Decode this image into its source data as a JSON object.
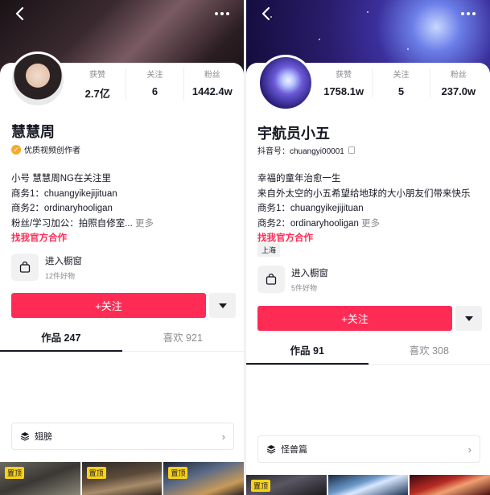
{
  "colors": {
    "accent": "#fe2c55",
    "pin": "#f8d21a",
    "text": "#161823",
    "muted": "#8a8b91"
  },
  "left": {
    "stats": [
      {
        "label": "获赞",
        "value": "2.7亿"
      },
      {
        "label": "关注",
        "value": "6"
      },
      {
        "label": "粉丝",
        "value": "1442.4w"
      }
    ],
    "name": "慧慧周",
    "badge": "优质视频创作者",
    "bio": [
      "小号 慧慧周NG在关注里",
      "商务1：chuangyikejijituan",
      "商务2：ordinaryhooligan",
      "粉丝/学习加公：拍照自修室..."
    ],
    "more": "更多",
    "link": "找我官方合作",
    "shop": {
      "title": "进入橱窗",
      "sub": "12件好物"
    },
    "follow": "+关注",
    "tabs": [
      {
        "label": "作品 247"
      },
      {
        "label": "喜欢 921"
      }
    ],
    "collection": "翅膀",
    "pin": "置顶"
  },
  "right": {
    "stats": [
      {
        "label": "获赞",
        "value": "1758.1w"
      },
      {
        "label": "关注",
        "value": "5"
      },
      {
        "label": "粉丝",
        "value": "237.0w"
      }
    ],
    "name": "宇航员小五",
    "id": "抖音号：chuangyi00001",
    "bio": [
      "幸福的童年治愈一生",
      "来自外太空的小五希望给地球的大小朋友们带来快乐",
      "商务1：chuangyikejijituan",
      "商务2：ordinaryhooligan"
    ],
    "more": "更多",
    "link": "找我官方合作",
    "location": "上海",
    "shop": {
      "title": "进入橱窗",
      "sub": "5件好物"
    },
    "follow": "+关注",
    "tabs": [
      {
        "label": "作品 91"
      },
      {
        "label": "喜欢 308"
      }
    ],
    "collection": "怪兽篇",
    "pin": "置顶"
  }
}
